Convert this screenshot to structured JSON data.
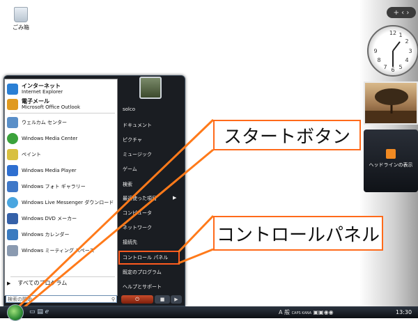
{
  "desktop": {
    "recycle_bin_label": "ごみ箱"
  },
  "sidebar": {
    "controls": "+ ‹ ›",
    "feed_title": "ヘッドラインの表示"
  },
  "start_menu": {
    "pinned": [
      {
        "title": "インターネット",
        "subtitle": "Internet Explorer",
        "icon": "ie-icon",
        "color": "#2a7fd4"
      },
      {
        "title": "電子メール",
        "subtitle": "Microsoft Office Outlook",
        "icon": "outlook-icon",
        "color": "#e09a20"
      }
    ],
    "recent": [
      {
        "label": "ウェルカム センター",
        "icon": "welcome-center-icon",
        "color": "#5a8fc8"
      },
      {
        "label": "Windows Media Center",
        "icon": "media-center-icon",
        "color": "#3ba23b"
      },
      {
        "label": "ペイント",
        "icon": "paint-icon",
        "color": "#d8c040"
      },
      {
        "label": "Windows Media Player",
        "icon": "media-player-icon",
        "color": "#2e6fd0"
      },
      {
        "label": "Windows フォト ギャラリー",
        "icon": "photo-gallery-icon",
        "color": "#3f78c8"
      },
      {
        "label": "Windows Live Messenger ダウンロード",
        "icon": "messenger-icon",
        "color": "#4aa6e0"
      },
      {
        "label": "Windows DVD メーカー",
        "icon": "dvd-maker-icon",
        "color": "#3561a8"
      },
      {
        "label": "Windows カレンダー",
        "icon": "calendar-icon",
        "color": "#3a7bc0"
      },
      {
        "label": "Windows ミーティング スペース",
        "icon": "meeting-space-icon",
        "color": "#8a9ab0"
      }
    ],
    "all_programs": "すべてのプログラム",
    "search_placeholder": "検索の開始",
    "right_items": [
      "solco",
      "ドキュメント",
      "ピクチャ",
      "ミュージック",
      "ゲーム",
      "検索",
      "最近使った項目",
      "コンピュータ",
      "ネットワーク",
      "接続先",
      "コントロール パネル",
      "既定のプログラム",
      "ヘルプとサポート"
    ]
  },
  "callouts": {
    "start_button": "スタートボタン",
    "control_panel": "コントロールパネル"
  },
  "taskbar": {
    "ime": "A 般",
    "caps": "CAPS KANA",
    "time": "13:30"
  },
  "colors": {
    "highlight": "#ff5a1f",
    "taskbar": "#1a1f27"
  }
}
